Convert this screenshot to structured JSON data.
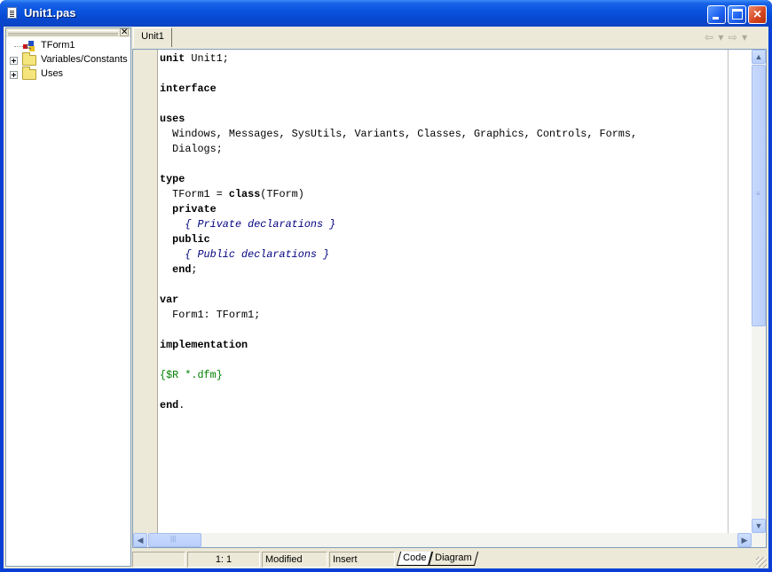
{
  "window": {
    "title": "Unit1.pas",
    "controls": [
      "minimize",
      "maximize",
      "close"
    ]
  },
  "explorer": {
    "close_glyph": "✕",
    "items": [
      {
        "label": "TForm1",
        "icon": "form-class-icon",
        "expandable": false
      },
      {
        "label": "Variables/Constants",
        "icon": "folder-icon",
        "expandable": true
      },
      {
        "label": "Uses",
        "icon": "folder-icon",
        "expandable": true
      }
    ]
  },
  "editor": {
    "tab_label": "Unit1",
    "nav_back": "⇦",
    "nav_forward": "⇨",
    "code_lines": [
      [
        {
          "t": "unit",
          "c": "kw"
        },
        {
          "t": " Unit1;",
          "c": ""
        }
      ],
      [],
      [
        {
          "t": "interface",
          "c": "kw"
        }
      ],
      [],
      [
        {
          "t": "uses",
          "c": "kw"
        }
      ],
      [
        {
          "t": "  Windows, Messages, SysUtils, Variants, Classes, Graphics, Controls, Forms,",
          "c": ""
        }
      ],
      [
        {
          "t": "  Dialogs;",
          "c": ""
        }
      ],
      [],
      [
        {
          "t": "type",
          "c": "kw"
        }
      ],
      [
        {
          "t": "  TForm1 = ",
          "c": ""
        },
        {
          "t": "class",
          "c": "kw"
        },
        {
          "t": "(TForm)",
          "c": ""
        }
      ],
      [
        {
          "t": "  ",
          "c": ""
        },
        {
          "t": "private",
          "c": "kw"
        }
      ],
      [
        {
          "t": "    { Private declarations }",
          "c": "cm"
        }
      ],
      [
        {
          "t": "  ",
          "c": ""
        },
        {
          "t": "public",
          "c": "kw"
        }
      ],
      [
        {
          "t": "    { Public declarations }",
          "c": "cm"
        }
      ],
      [
        {
          "t": "  ",
          "c": ""
        },
        {
          "t": "end",
          "c": "kw"
        },
        {
          "t": ";",
          "c": ""
        }
      ],
      [],
      [
        {
          "t": "var",
          "c": "kw"
        }
      ],
      [
        {
          "t": "  Form1: TForm1;",
          "c": ""
        }
      ],
      [],
      [
        {
          "t": "implementation",
          "c": "kw"
        }
      ],
      [],
      [
        {
          "t": "{$R *.dfm}",
          "c": "dir"
        }
      ],
      [],
      [
        {
          "t": "end",
          "c": "kw"
        },
        {
          "t": ".",
          "c": ""
        }
      ]
    ]
  },
  "status": {
    "position": "1:   1",
    "modified": "Modified",
    "mode": "Insert",
    "view_tabs": [
      "Code",
      "Diagram"
    ],
    "active_view": "Code"
  },
  "colors": {
    "titlebar": "#0a54e0",
    "chrome": "#ece9d8",
    "comment": "#000080",
    "directive": "#008000"
  }
}
